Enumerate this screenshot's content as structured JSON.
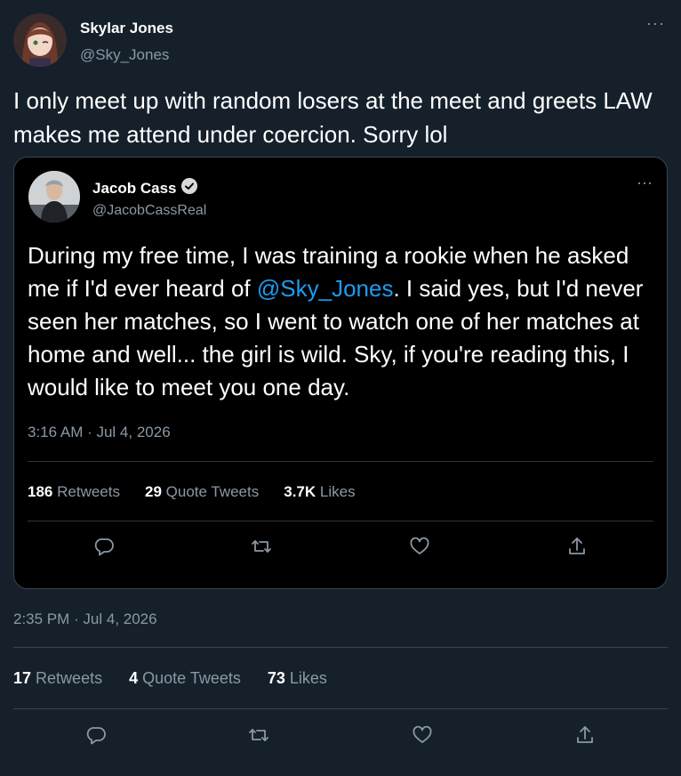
{
  "author": {
    "name": "Skylar Jones",
    "handle": "@Sky_Jones"
  },
  "tweet": {
    "text": "I only meet up with random losers at the meet and greets LAW makes me attend under coercion. Sorry lol",
    "timestamp": "2:35 PM · Jul 4, 2026",
    "stats": {
      "retweets_count": "17",
      "retweets_label": "Retweets",
      "quotes_count": "4",
      "quotes_label": "Quote Tweets",
      "likes_count": "73",
      "likes_label": "Likes"
    }
  },
  "quoted": {
    "name": "Jacob Cass",
    "handle": "@JacobCassReal",
    "text_before": "During my free time, I was training a rookie when he asked me if I'd ever heard of ",
    "mention": "@Sky_Jones",
    "text_after": ". I said yes, but I'd never seen her matches, so I went to watch one of her matches at home and well... the girl is wild. Sky, if you're reading this, I would like to meet you one day.",
    "timestamp": "3:16 AM · Jul 4, 2026",
    "stats": {
      "retweets_count": "186",
      "retweets_label": "Retweets",
      "quotes_count": "29",
      "quotes_label": "Quote Tweets",
      "likes_count": "3.7K",
      "likes_label": "Likes"
    }
  },
  "more_glyph": "···",
  "icons": [
    "reply-icon",
    "retweet-icon",
    "like-icon",
    "share-icon",
    "verified-icon",
    "more-icon"
  ],
  "colors": {
    "background": "#15202b",
    "quote_background": "#000000",
    "link": "#1d9bf0",
    "secondary": "#8b98a5"
  }
}
